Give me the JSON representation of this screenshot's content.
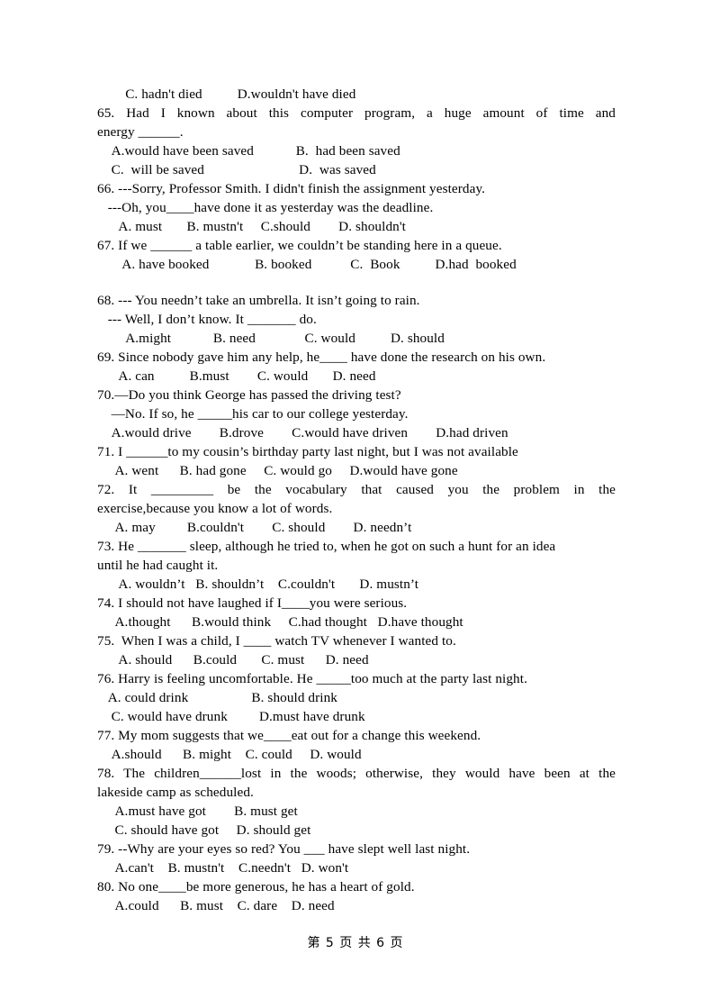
{
  "page": {
    "footer": "第 5 页 共 6 页",
    "page_number": "5",
    "total_pages": "6"
  },
  "lines": [
    {
      "id": "q64-options-cd",
      "text": "        C. hadn't died          D.wouldn't have died",
      "style": "plain"
    },
    {
      "id": "q65-stem-1",
      "text": "65. Had I known about this computer program, a huge amount of time and",
      "style": "justify-full"
    },
    {
      "id": "q65-stem-2",
      "text": "energy ______.",
      "style": "plain"
    },
    {
      "id": "q65-options-ab",
      "text": "    A.would have been saved            B.  had been saved",
      "style": "plain"
    },
    {
      "id": "q65-options-cd",
      "text": "    C.  will be saved                           D.  was saved",
      "style": "plain"
    },
    {
      "id": "q66-stem-1",
      "text": "66. ---Sorry, Professor Smith. I didn't finish the assignment yesterday.",
      "style": "plain"
    },
    {
      "id": "q66-stem-2",
      "text": "   ---Oh, you____have done it as yesterday was the deadline.",
      "style": "plain"
    },
    {
      "id": "q66-options",
      "text": "      A. must       B. mustn't     C.should        D. shouldn't",
      "style": "plain"
    },
    {
      "id": "q67-stem",
      "text": "67. If we ______ a table earlier, we couldn’t be standing here in a queue.",
      "style": "plain"
    },
    {
      "id": "q67-options",
      "text": "       A. have booked             B. booked           C.  Book          D.had  booked",
      "style": "plain"
    },
    {
      "id": "spacer-1",
      "text": "",
      "style": "spacer"
    },
    {
      "id": "q68-stem-1",
      "text": "68. --- You needn’t take an umbrella. It isn’t going to rain.",
      "style": "plain"
    },
    {
      "id": "q68-stem-2",
      "text": "   --- Well, I don’t know. It _______ do.",
      "style": "plain"
    },
    {
      "id": "q68-options",
      "text": "        A.might            B. need              C. would          D. should",
      "style": "plain"
    },
    {
      "id": "q69-stem",
      "text": "69. Since nobody gave him any help, he____ have done the research on his own.",
      "style": "plain"
    },
    {
      "id": "q69-options",
      "text": "      A. can          B.must        C. would       D. need",
      "style": "plain"
    },
    {
      "id": "q70-stem-1",
      "text": "70.—Do you think George has passed the driving test?",
      "style": "plain"
    },
    {
      "id": "q70-stem-2",
      "text": "    —No. If so, he _____his car to our college yesterday.",
      "style": "plain"
    },
    {
      "id": "q70-options",
      "text": "    A.would drive        B.drove        C.would have driven        D.had driven",
      "style": "plain"
    },
    {
      "id": "q71-stem",
      "text": "71. I ______to my cousin’s birthday party last night, but I was not available",
      "style": "plain"
    },
    {
      "id": "q71-options",
      "text": "     A. went      B. had gone     C. would go     D.would have gone",
      "style": "plain"
    },
    {
      "id": "q72-stem-1",
      "text": "72. It _________ be the vocabulary that caused you the problem in the",
      "style": "justify-full"
    },
    {
      "id": "q72-stem-2",
      "text": "exercise,because you know a lot of words.",
      "style": "plain"
    },
    {
      "id": "q72-options",
      "text": "     A. may         B.couldn't        C. should        D. needn’t",
      "style": "plain"
    },
    {
      "id": "q73-stem-1",
      "text": "73. He _______ sleep, although he tried to, when he got on such a hunt for an idea",
      "style": "plain"
    },
    {
      "id": "q73-stem-2",
      "text": "until he had caught it.",
      "style": "plain"
    },
    {
      "id": "q73-options",
      "text": "      A. wouldn’t   B. shouldn’t    C.couldn't       D. mustn’t",
      "style": "plain"
    },
    {
      "id": "q74-stem",
      "text": "74. I should not have laughed if I____you were serious.",
      "style": "plain"
    },
    {
      "id": "q74-options",
      "text": "     A.thought      B.would think     C.had thought   D.have thought",
      "style": "plain"
    },
    {
      "id": "q75-stem",
      "text": "75.  When I was a child, I ____ watch TV whenever I wanted to.",
      "style": "plain"
    },
    {
      "id": "q75-options",
      "text": "      A. should      B.could       C. must      D. need",
      "style": "plain"
    },
    {
      "id": "q76-stem",
      "text": "76. Harry is feeling uncomfortable. He _____too much at the party last night.",
      "style": "plain"
    },
    {
      "id": "q76-options-ab",
      "text": "   A. could drink                  B. should drink",
      "style": "plain"
    },
    {
      "id": "q76-options-cd",
      "text": "    C. would have drunk         D.must have drunk",
      "style": "plain"
    },
    {
      "id": "q77-stem",
      "text": "77. My mom suggests that we____eat out for a change this weekend.",
      "style": "plain"
    },
    {
      "id": "q77-options",
      "text": "    A.should      B. might    C. could     D. would",
      "style": "plain"
    },
    {
      "id": "q78-stem-1",
      "text": "78. The children______lost in the woods; otherwise, they would have been at the",
      "style": "justify-full"
    },
    {
      "id": "q78-stem-2",
      "text": "lakeside camp as scheduled.",
      "style": "plain"
    },
    {
      "id": "q78-options-ab",
      "text": "     A.must have got        B. must get",
      "style": "plain"
    },
    {
      "id": "q78-options-cd",
      "text": "     C. should have got     D. should get",
      "style": "plain"
    },
    {
      "id": "q79-stem",
      "text": "79. --Why are your eyes so red? You ___ have slept well last night.",
      "style": "plain"
    },
    {
      "id": "q79-options",
      "text": "     A.can't    B. mustn't    C.needn't   D. won't",
      "style": "plain"
    },
    {
      "id": "q80-stem",
      "text": "80. No one____be more generous, he has a heart of gold.",
      "style": "plain"
    },
    {
      "id": "q80-options",
      "text": "     A.could      B. must    C. dare    D. need",
      "style": "plain"
    }
  ],
  "questions": [
    {
      "number": "65",
      "stem": "Had I known about this computer program, a huge amount of time and energy ______.",
      "options": [
        "A.would have been saved",
        "B.  had been saved",
        "C.  will be saved",
        "D.  was saved"
      ]
    },
    {
      "number": "66",
      "stem": "---Sorry, Professor Smith. I didn't finish the assignment yesterday. ---Oh, you____have done it as yesterday was the deadline.",
      "options": [
        "A. must",
        "B. mustn't",
        "C.should",
        "D. shouldn't"
      ]
    },
    {
      "number": "67",
      "stem": "If we ______ a table earlier, we couldn’t be standing here in a queue.",
      "options": [
        "A. have booked",
        "B. booked",
        "C.  Book",
        "D.had  booked"
      ]
    },
    {
      "number": "68",
      "stem": "--- You needn’t take an umbrella. It isn’t going to rain. --- Well, I don’t know. It _______ do.",
      "options": [
        "A.might",
        "B. need",
        "C. would",
        "D. should"
      ]
    },
    {
      "number": "69",
      "stem": "Since nobody gave him any help, he____ have done the research on his own.",
      "options": [
        "A. can",
        "B.must",
        "C. would",
        "D. need"
      ]
    },
    {
      "number": "70",
      "stem": "—Do you think George has passed the driving test? —No. If so, he _____his car to our college yesterday.",
      "options": [
        "A.would drive",
        "B.drove",
        "C.would have driven",
        "D.had driven"
      ]
    },
    {
      "number": "71",
      "stem": "I ______to my cousin’s birthday party last night, but I was not available",
      "options": [
        "A. went",
        "B. had gone",
        "C. would go",
        "D.would have gone"
      ]
    },
    {
      "number": "72",
      "stem": "It _________ be the vocabulary that caused you the problem in the exercise,because you know a lot of words.",
      "options": [
        "A. may",
        "B.couldn't",
        "C. should",
        "D. needn’t"
      ]
    },
    {
      "number": "73",
      "stem": "He _______ sleep, although he tried to, when he got on such a hunt for an idea until he had caught it.",
      "options": [
        "A. wouldn’t",
        "B. shouldn’t",
        "C.couldn't",
        "D. mustn’t"
      ]
    },
    {
      "number": "74",
      "stem": "I should not have laughed if I____you were serious.",
      "options": [
        "A.thought",
        "B.would think",
        "C.had thought",
        "D.have thought"
      ]
    },
    {
      "number": "75",
      "stem": "When I was a child, I ____ watch TV whenever I wanted to.",
      "options": [
        "A. should",
        "B.could",
        "C. must",
        "D. need"
      ]
    },
    {
      "number": "76",
      "stem": "Harry is feeling uncomfortable. He _____too much at the party last night.",
      "options": [
        "A. could drink",
        "B. should drink",
        "C. would have drunk",
        "D.must have drunk"
      ]
    },
    {
      "number": "77",
      "stem": "My mom suggests that we____eat out for a change this weekend.",
      "options": [
        "A.should",
        "B. might",
        "C. could",
        "D. would"
      ]
    },
    {
      "number": "78",
      "stem": "The children______lost in the woods; otherwise, they would have been at the lakeside camp as scheduled.",
      "options": [
        "A.must have got",
        "B. must get",
        "C. should have got",
        "D. should get"
      ]
    },
    {
      "number": "79",
      "stem": "--Why are your eyes so red? You ___ have slept well last night.",
      "options": [
        "A.can't",
        "B. mustn't",
        "C.needn't",
        "D. won't"
      ]
    },
    {
      "number": "80",
      "stem": "No one____be more generous, he has a heart of gold.",
      "options": [
        "A.could",
        "B. must",
        "C. dare",
        "D. need"
      ]
    }
  ]
}
